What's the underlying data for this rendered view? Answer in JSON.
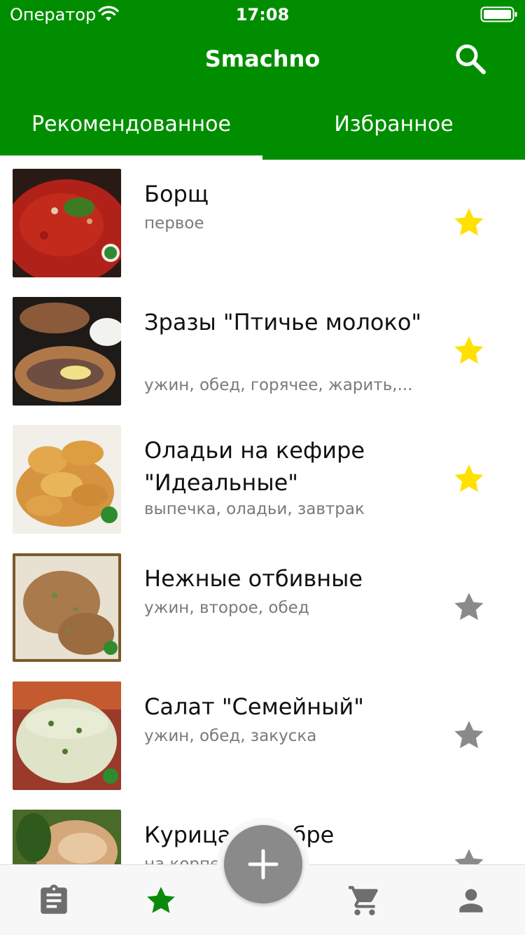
{
  "status": {
    "carrier": "Оператор",
    "time": "17:08"
  },
  "header": {
    "title": "Smachno"
  },
  "tabs": [
    {
      "label": "Рекомендованное",
      "active": true
    },
    {
      "label": "Избранное",
      "active": false
    }
  ],
  "recipes": [
    {
      "title": "Борщ",
      "tags": "первое",
      "favorite": true
    },
    {
      "title": "Зразы \"Птичье молоко\"",
      "tags": "ужин, обед, горячее, жарить,...",
      "favorite": true
    },
    {
      "title": "Оладьи на кефире \"Идеальные\"",
      "tags": "выпечка, оладьи, завтрак",
      "favorite": true
    },
    {
      "title": "Нежные отбивные",
      "tags": "ужин, второе, обед",
      "favorite": false
    },
    {
      "title": "Салат \"Семейный\"",
      "tags": "ужин, обед, закуска",
      "favorite": false
    },
    {
      "title": "Курица в шубре",
      "tags": "на корпе",
      "favorite": false
    }
  ],
  "bottom_nav": [
    {
      "icon": "clipboard-icon"
    },
    {
      "icon": "star-icon",
      "active": true
    },
    {
      "icon": "plus-icon"
    },
    {
      "icon": "cart-icon"
    },
    {
      "icon": "person-icon"
    }
  ],
  "colors": {
    "primary": "#008e00",
    "star_active": "#ffe000",
    "star_inactive": "#8a8a8a",
    "fab": "#8a8a8a"
  }
}
